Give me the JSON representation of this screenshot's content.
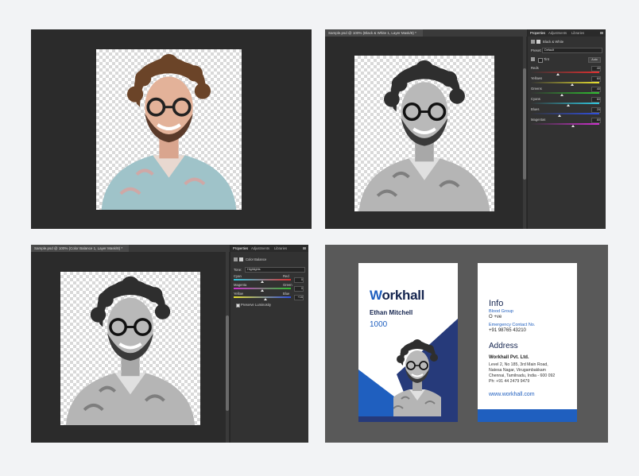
{
  "photoshop_bw": {
    "document_tab": "Sample.psd @ 100% (Black & White 1, Layer Mask/8) *",
    "panel_tabs": [
      "Properties",
      "Adjustments",
      "Libraries"
    ],
    "adjustment_title": "Black & White",
    "preset_label": "Preset:",
    "preset_value": "Default",
    "tint_label": "Tint",
    "auto_label": "Auto",
    "sliders": [
      {
        "name": "Reds",
        "value": "40",
        "position": 0.4,
        "gradient": "linear-gradient(90deg,#333,#e03030)"
      },
      {
        "name": "Yellows",
        "value": "60",
        "position": 0.6,
        "gradient": "linear-gradient(90deg,#333,#e8e030)"
      },
      {
        "name": "Greens",
        "value": "40",
        "position": 0.45,
        "gradient": "linear-gradient(90deg,#333,#30c030)"
      },
      {
        "name": "Cyans",
        "value": "60",
        "position": 0.55,
        "gradient": "linear-gradient(90deg,#333,#30c8e0)"
      },
      {
        "name": "Blues",
        "value": "20",
        "position": 0.42,
        "gradient": "linear-gradient(90deg,#333,#3050e0)"
      },
      {
        "name": "Magentas",
        "value": "80",
        "position": 0.62,
        "gradient": "linear-gradient(90deg,#333,#d030d0)"
      }
    ]
  },
  "photoshop_cb": {
    "document_tab": "Sample.psd @ 100% (Color Balance 1, Layer Mask/8) *",
    "panel_tabs": [
      "Properties",
      "Adjustments",
      "Libraries"
    ],
    "adjustment_title": "Color Balance",
    "tone_label": "Tone:",
    "tone_value": "Highlights",
    "sliders": [
      {
        "left": "Cyan",
        "right": "Red",
        "value": "0",
        "position": 0.5,
        "gradient": "linear-gradient(90deg,#30c8e0,#e03030)"
      },
      {
        "left": "Magenta",
        "right": "Green",
        "value": "0",
        "position": 0.5,
        "gradient": "linear-gradient(90deg,#d030d0,#30c030)"
      },
      {
        "left": "Yellow",
        "right": "Blue",
        "value": "+16",
        "position": 0.56,
        "gradient": "linear-gradient(90deg,#e8e030,#3050e0)"
      }
    ],
    "preserve_luminosity": "Preserve Luminosity"
  },
  "id_card_front": {
    "logo_w": "W",
    "logo_rest": "orkhall",
    "name": "Ethan Mitchell",
    "id_number": "1000"
  },
  "id_card_back": {
    "info_heading": "Info",
    "blood_group_label": "Blood Group",
    "blood_group_value": "O +ve",
    "emergency_label": "Emergency Contact No.",
    "emergency_value": "+91 98765 43210",
    "address_heading": "Address",
    "company": "Workhall Pvt. Ltd.",
    "address_line1": "Level 2, No 185, 3rd Main Road,",
    "address_line2": "Natesa Nagar, Virugambakkam",
    "address_line3": "Chennai, Tamilnadu, India - 600 092",
    "phone": "Ph: +91 44 2479 9479",
    "website": "www.workhall.com"
  },
  "colors": {
    "brand_blue": "#1f5fbf",
    "navy": "#263a7a",
    "logo_navy": "#15254f"
  }
}
